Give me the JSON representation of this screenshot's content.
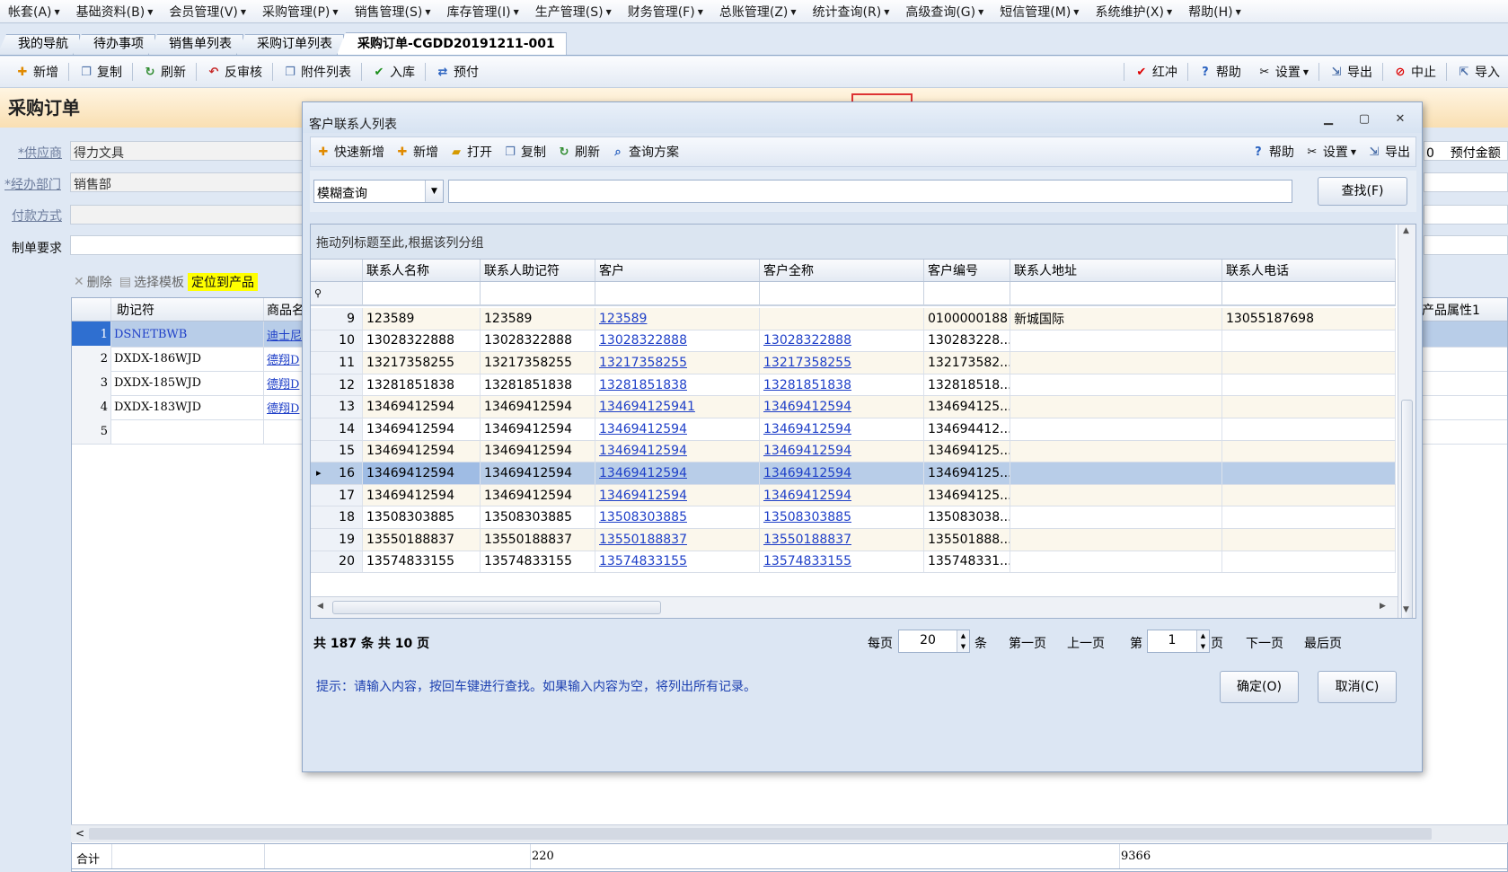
{
  "menu": [
    "帐套(A)",
    "基础资料(B)",
    "会员管理(V)",
    "采购管理(P)",
    "销售管理(S)",
    "库存管理(I)",
    "生产管理(S)",
    "财务管理(F)",
    "总账管理(Z)",
    "统计查询(R)",
    "高级查询(G)",
    "短信管理(M)",
    "系统维护(X)",
    "帮助(H)"
  ],
  "tabs": [
    "我的导航",
    "待办事项",
    "销售单列表",
    "采购订单列表",
    "采购订单-CGDD20191211-001"
  ],
  "toolbar": {
    "new": "新增",
    "copy": "复制",
    "refresh": "刷新",
    "unaudit": "反审核",
    "attachments": "附件列表",
    "stock_in": "入库",
    "prepay": "预付",
    "red": "红冲",
    "help": "帮助",
    "settings": "设置",
    "export": "导出",
    "stop": "中止",
    "import": "导入"
  },
  "page_title": "采购订单",
  "form": {
    "supplier_label": "*供应商",
    "supplier_value": "得力文具",
    "dept_label": "*经办部门",
    "dept_value": "销售部",
    "payment_label": "付款方式",
    "payment_value": "",
    "requirement_label": "制单要求",
    "requirement_value": "",
    "prepay_num": "0",
    "prepay_label": "预付金额"
  },
  "detail_tool": {
    "delete": "删除",
    "template": "选择模板",
    "locate": "定位到产品"
  },
  "detail_grid": {
    "headers": [
      "助记符",
      "商品名",
      "产品属性1"
    ],
    "rows": [
      {
        "n": "1",
        "code": "DSNETBWB",
        "name": "迪士尼"
      },
      {
        "n": "2",
        "code": "DXDX-186WJD",
        "name": "德翔D"
      },
      {
        "n": "3",
        "code": "DXDX-185WJD",
        "name": "德翔D"
      },
      {
        "n": "4",
        "code": "DXDX-183WJD",
        "name": "德翔D"
      },
      {
        "n": "5",
        "code": "",
        "name": ""
      }
    ],
    "totals_label": "合计",
    "total_qty": "220",
    "total_amount": "9366"
  },
  "dialog": {
    "title": "客户联系人列表",
    "toolbar": {
      "quick_new": "快速新增",
      "new": "新增",
      "open": "打开",
      "copy": "复制",
      "refresh": "刷新",
      "query_plan": "查询方案",
      "help": "帮助",
      "settings": "设置",
      "export": "导出"
    },
    "search_mode": "模糊查询",
    "search_value": "",
    "find_button": "查找(F)",
    "group_hint": "拖动列标题至此,根据该列分组",
    "columns": [
      "联系人名称",
      "联系人助记符",
      "客户",
      "客户全称",
      "客户编号",
      "联系人地址",
      "联系人电话"
    ],
    "rows": [
      {
        "n": "9",
        "name": "123589",
        "mnemonic": "123589",
        "customer": "123589",
        "fullname": "",
        "code": "0100000188",
        "address": "新城国际",
        "phone": "13055187698"
      },
      {
        "n": "10",
        "name": "13028322888",
        "mnemonic": "13028322888",
        "customer": "13028322888",
        "fullname": "13028322888",
        "code": "130283228...",
        "address": "",
        "phone": ""
      },
      {
        "n": "11",
        "name": "13217358255",
        "mnemonic": "13217358255",
        "customer": "13217358255",
        "fullname": "13217358255",
        "code": "132173582...",
        "address": "",
        "phone": ""
      },
      {
        "n": "12",
        "name": "13281851838",
        "mnemonic": "13281851838",
        "customer": "13281851838",
        "fullname": "13281851838",
        "code": "132818518...",
        "address": "",
        "phone": ""
      },
      {
        "n": "13",
        "name": "13469412594",
        "mnemonic": "13469412594",
        "customer": "134694125941",
        "fullname": "13469412594",
        "code": "134694125...",
        "address": "",
        "phone": ""
      },
      {
        "n": "14",
        "name": "13469412594",
        "mnemonic": "13469412594",
        "customer": "13469412594",
        "fullname": "13469412594",
        "code": "134694412...",
        "address": "",
        "phone": ""
      },
      {
        "n": "15",
        "name": "13469412594",
        "mnemonic": "13469412594",
        "customer": "13469412594",
        "fullname": "13469412594",
        "code": "134694125...",
        "address": "",
        "phone": ""
      },
      {
        "n": "16",
        "name": "13469412594",
        "mnemonic": "13469412594",
        "customer": "13469412594",
        "fullname": "13469412594",
        "code": "134694125...",
        "address": "",
        "phone": ""
      },
      {
        "n": "17",
        "name": "13469412594",
        "mnemonic": "13469412594",
        "customer": "13469412594",
        "fullname": "13469412594",
        "code": "134694125...",
        "address": "",
        "phone": ""
      },
      {
        "n": "18",
        "name": "13508303885",
        "mnemonic": "13508303885",
        "customer": "13508303885",
        "fullname": "13508303885",
        "code": "135083038...",
        "address": "",
        "phone": ""
      },
      {
        "n": "19",
        "name": "13550188837",
        "mnemonic": "13550188837",
        "customer": "13550188837",
        "fullname": "13550188837",
        "code": "135501888...",
        "address": "",
        "phone": ""
      },
      {
        "n": "20",
        "name": "13574833155",
        "mnemonic": "13574833155",
        "customer": "13574833155",
        "fullname": "13574833155",
        "code": "135748331...",
        "address": "",
        "phone": ""
      }
    ],
    "selected_row": "16",
    "pager": {
      "summary": "共 187 条  共 10 页",
      "per_page_label": "每页",
      "per_page": "20",
      "per_unit": "条",
      "first": "第一页",
      "prev": "上一页",
      "page_prefix": "第",
      "page": "1",
      "page_suffix": "页",
      "next": "下一页",
      "last": "最后页"
    },
    "hint": "提示：请输入内容，按回车键进行查找。如果输入内容为空，将列出所有记录。",
    "ok": "确定(O)",
    "cancel": "取消(C)"
  }
}
